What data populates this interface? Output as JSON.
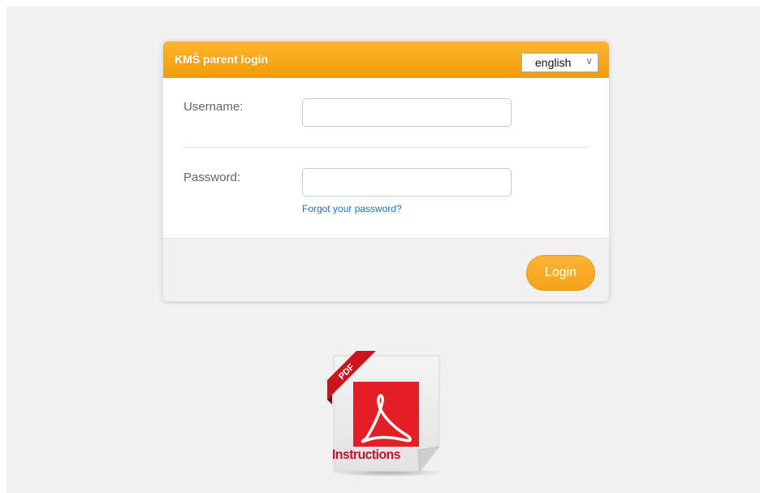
{
  "login": {
    "title": "KMŠ parent login",
    "language": {
      "selected": "english"
    },
    "username_label": "Username:",
    "username_value": "",
    "password_label": "Password:",
    "password_value": "",
    "forgot_link": "Forgot your password?",
    "login_button": "Login"
  },
  "instructions": {
    "ribbon_text": "PDF",
    "label": "Instructions"
  },
  "colors": {
    "accent": "#f5a21a",
    "header": "#fdb52a",
    "link": "#1a73c8",
    "pdf_red": "#e31e24"
  }
}
